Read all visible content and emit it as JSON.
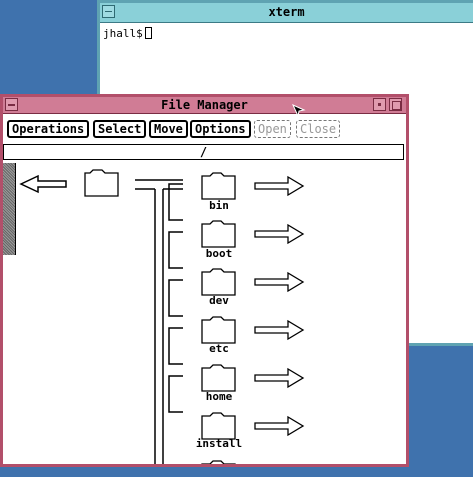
{
  "xterm": {
    "title": "xterm",
    "prompt": "jhall$"
  },
  "file_manager": {
    "title": "File Manager",
    "menu": [
      "Operations",
      "Select",
      "Move",
      "Options",
      "Open",
      "Close"
    ],
    "menu_disabled": [
      false,
      false,
      false,
      false,
      true,
      true
    ],
    "path": "/",
    "folders": [
      "bin",
      "boot",
      "dev",
      "etc",
      "home",
      "install"
    ]
  },
  "colors": {
    "desktop": "#3f72ad",
    "xterm_frame": "#8ad0d8",
    "fm_frame": "#d07c95"
  }
}
